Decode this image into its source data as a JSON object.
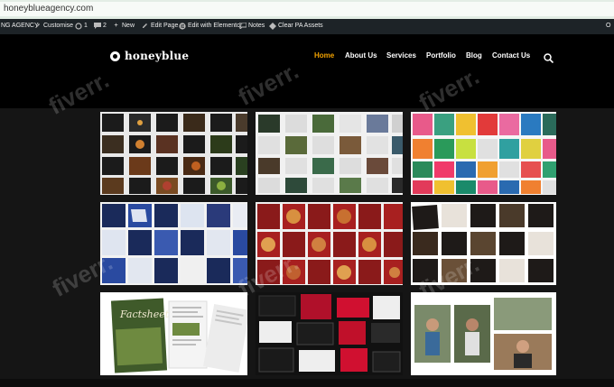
{
  "browser": {
    "url": "honeyblueagency.com"
  },
  "admin_bar": {
    "site_name": "NG AGENCY",
    "customise": "Customise",
    "updates_count": "1",
    "comments_count": "2",
    "new_label": "New",
    "edit_page": "Edit Page",
    "edit_elementor": "Edit with Elementor",
    "notes": "Notes",
    "clear_assets": "Clear PA Assets",
    "right_user": "O"
  },
  "site": {
    "logo_text": "honeyblue",
    "nav": [
      {
        "label": "Home",
        "active": true
      },
      {
        "label": "About Us",
        "active": false
      },
      {
        "label": "Services",
        "active": false
      },
      {
        "label": "Portfolio",
        "active": false
      },
      {
        "label": "Blog",
        "active": false
      },
      {
        "label": "Contact Us",
        "active": false
      }
    ]
  },
  "portfolio": {
    "factsheet_title": "Factsheet",
    "tiles": [
      {
        "name": "social-grid-food-dark",
        "bg": "#e9e9e9"
      },
      {
        "name": "social-grid-travel-light",
        "bg": "#f1f1f1"
      },
      {
        "name": "social-grid-colorful-people",
        "bg": "#f6f6f6"
      },
      {
        "name": "social-grid-corporate-blue",
        "bg": "#f2f2f2"
      },
      {
        "name": "social-grid-food-red",
        "bg": "#f0f0f0"
      },
      {
        "name": "social-grid-coffee-dark",
        "bg": "#ffffff"
      },
      {
        "name": "factsheet-brochure",
        "bg": "#ffffff"
      },
      {
        "name": "brand-identity-black-red",
        "bg": "#111111"
      },
      {
        "name": "photo-collage-team",
        "bg": "#ffffff"
      }
    ]
  },
  "watermark": {
    "text": "fiverr."
  },
  "colors": {
    "accent": "#f2a200",
    "header_bg": "#000000",
    "admin_bg": "#1d2327"
  }
}
